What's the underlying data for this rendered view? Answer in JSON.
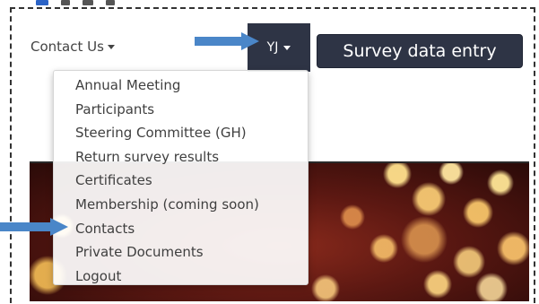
{
  "navbar": {
    "contact_us_label": "Contact Us",
    "user_initials": "YJ",
    "survey_button_label": "Survey data entry"
  },
  "dropdown": {
    "items": [
      {
        "label": "Annual Meeting"
      },
      {
        "label": "Participants"
      },
      {
        "label": "Steering Committee (GH)"
      },
      {
        "label": "Return survey results"
      },
      {
        "label": "Certificates"
      },
      {
        "label": "Membership (coming soon)"
      },
      {
        "label": "Contacts"
      },
      {
        "label": "Private Documents"
      },
      {
        "label": "Logout"
      }
    ]
  },
  "colors": {
    "nav_dark": "#2e3445",
    "arrow": "#4a86c8",
    "menu_text": "#3f3f3f"
  }
}
